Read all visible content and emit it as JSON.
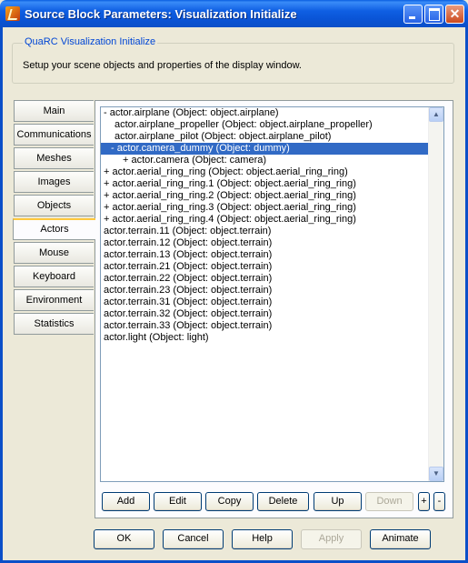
{
  "window": {
    "title": "Source Block Parameters: Visualization Initialize",
    "controls": {
      "close": "✕"
    }
  },
  "group": {
    "title": "QuaRC Visualization Initialize",
    "description": "Setup your scene objects and properties of the display window."
  },
  "tabs": [
    {
      "label": "Main"
    },
    {
      "label": "Communications"
    },
    {
      "label": "Meshes"
    },
    {
      "label": "Images"
    },
    {
      "label": "Objects"
    },
    {
      "label": "Actors",
      "active": true
    },
    {
      "label": "Mouse"
    },
    {
      "label": "Keyboard"
    },
    {
      "label": "Environment"
    },
    {
      "label": "Statistics"
    }
  ],
  "actors_list": [
    {
      "text": "- actor.airplane (Object: object.airplane)"
    },
    {
      "text": "actor.airplane_propeller (Object: object.airplane_propeller)"
    },
    {
      "text": "actor.airplane_pilot (Object: object.airplane_pilot)"
    },
    {
      "text": "- actor.camera_dummy (Object: dummy)",
      "selected": true
    },
    {
      "text": "+ actor.camera (Object: camera)"
    },
    {
      "text": "+ actor.aerial_ring_ring (Object: object.aerial_ring_ring)"
    },
    {
      "text": "+ actor.aerial_ring_ring.1 (Object: object.aerial_ring_ring)"
    },
    {
      "text": "+ actor.aerial_ring_ring.2 (Object: object.aerial_ring_ring)"
    },
    {
      "text": "+ actor.aerial_ring_ring.3 (Object: object.aerial_ring_ring)"
    },
    {
      "text": "+ actor.aerial_ring_ring.4 (Object: object.aerial_ring_ring)"
    },
    {
      "text": "actor.terrain.11 (Object: object.terrain)"
    },
    {
      "text": "actor.terrain.12 (Object: object.terrain)"
    },
    {
      "text": "actor.terrain.13 (Object: object.terrain)"
    },
    {
      "text": "actor.terrain.21 (Object: object.terrain)"
    },
    {
      "text": "actor.terrain.22 (Object: object.terrain)"
    },
    {
      "text": "actor.terrain.23 (Object: object.terrain)"
    },
    {
      "text": "actor.terrain.31 (Object: object.terrain)"
    },
    {
      "text": "actor.terrain.32 (Object: object.terrain)"
    },
    {
      "text": "actor.terrain.33 (Object: object.terrain)"
    },
    {
      "text": "actor.light (Object: light)"
    }
  ],
  "actor_buttons": {
    "add": "Add",
    "edit": "Edit",
    "copy": "Copy",
    "delete": "Delete",
    "up": "Up",
    "down": "Down",
    "plus": "+",
    "minus": "-"
  },
  "dialog_buttons": {
    "ok": "OK",
    "cancel": "Cancel",
    "help": "Help",
    "apply": "Apply",
    "animate": "Animate"
  },
  "icons": {
    "scroll_up": "▲",
    "scroll_down": "▼"
  }
}
